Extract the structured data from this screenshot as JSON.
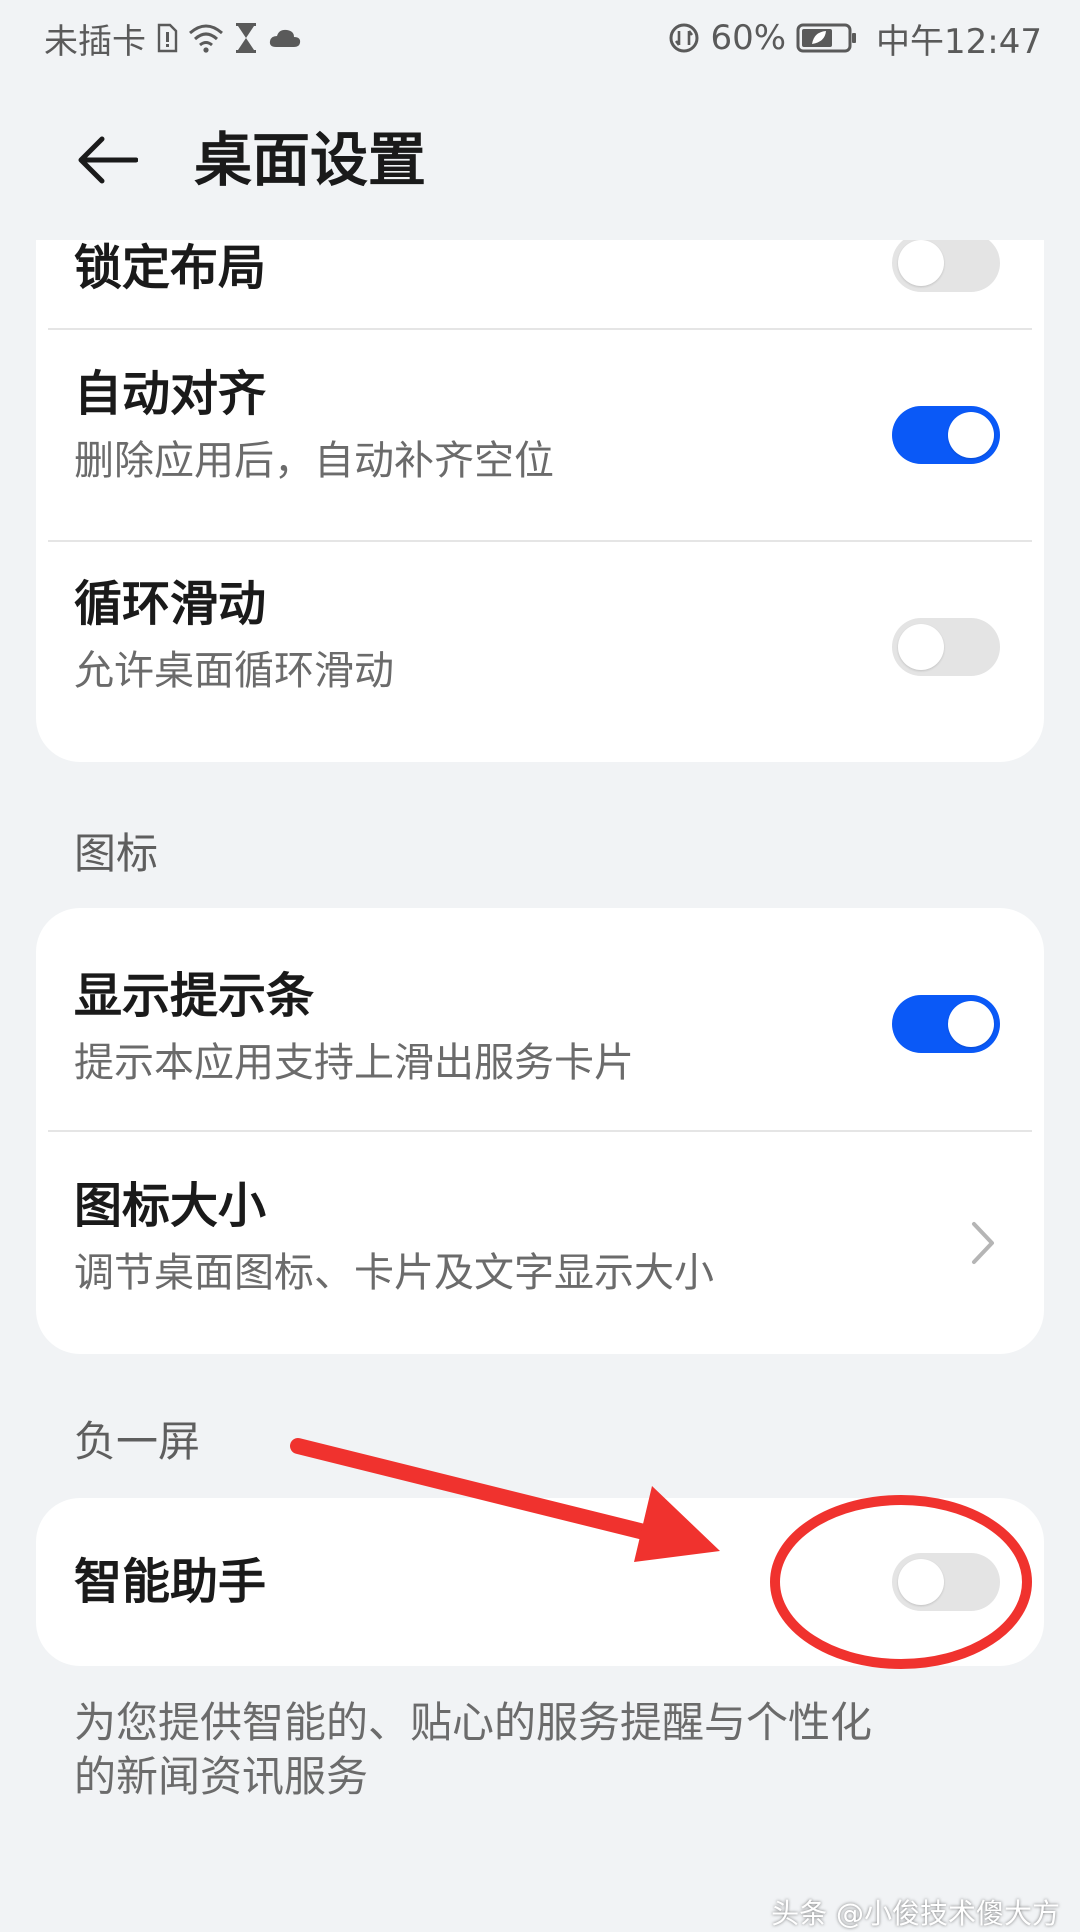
{
  "status_bar": {
    "carrier": "未插卡",
    "battery_percent": "60%",
    "time": "中午12:47",
    "icons": [
      "sim-alert-icon",
      "wifi-icon",
      "hourglass-icon",
      "cloud-icon",
      "data-saver-icon",
      "battery-icon"
    ]
  },
  "header": {
    "title": "桌面设置"
  },
  "sections": {
    "layout": {
      "rows": [
        {
          "title": "锁定布局",
          "enabled": false
        },
        {
          "title": "自动对齐",
          "subtitle": "删除应用后，自动补齐空位",
          "enabled": true
        },
        {
          "title": "循环滑动",
          "subtitle": "允许桌面循环滑动",
          "enabled": false
        }
      ]
    },
    "icons": {
      "label": "图标",
      "rows": [
        {
          "title": "显示提示条",
          "subtitle": "提示本应用支持上滑出服务卡片",
          "enabled": true
        },
        {
          "title": "图标大小",
          "subtitle": "调节桌面图标、卡片及文字显示大小"
        }
      ]
    },
    "minus_one": {
      "label": "负一屏",
      "rows": [
        {
          "title": "智能助手",
          "enabled": false
        }
      ],
      "description_line1": "为您提供智能的、贴心的服务提醒与个性化",
      "description_line2": "的新闻资讯服务"
    }
  },
  "colors": {
    "accent": "#0a59f7",
    "toggle_off": "#e4e4e4",
    "annotation": "#f0322e",
    "background": "#f1f3f5"
  },
  "watermark": "头条 @小俊技术傻大方"
}
